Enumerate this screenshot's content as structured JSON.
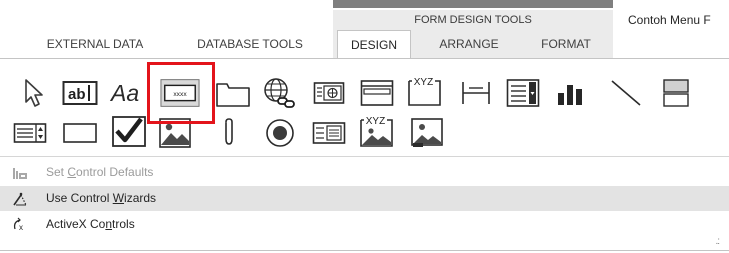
{
  "ribbon": {
    "context_group": "FORM DESIGN TOOLS",
    "app_title": "Contoh Menu F",
    "tabs": [
      {
        "label": "EXTERNAL DATA"
      },
      {
        "label": "DATABASE TOOLS"
      },
      {
        "label": "DESIGN",
        "active": true
      },
      {
        "label": "ARRANGE"
      },
      {
        "label": "FORMAT"
      }
    ]
  },
  "controls_gallery": {
    "row1": [
      "select-arrow-icon",
      "text-box-icon",
      "label-icon",
      "button-icon",
      "tab-control-icon",
      "hyperlink-icon",
      "web-browser-icon",
      "navigation-control-icon",
      "option-group-icon",
      "page-break-icon",
      "combo-box-icon",
      "chart-icon",
      "line-icon",
      "toggle-button-icon"
    ],
    "row2": [
      "list-box-icon",
      "rectangle-icon",
      "check-box-icon",
      "unbound-object-frame-icon",
      "attachment-icon",
      "option-button-icon",
      "subform-icon",
      "bound-object-frame-icon",
      "image-icon"
    ],
    "button_icon_text": "xxxx",
    "option_group_text": "XYZ",
    "bound_frame_text": "XYZ",
    "highlighted_control": "button-icon",
    "highlight_color": "#e3141b"
  },
  "menu": {
    "items": [
      {
        "label_pre": "Set ",
        "label_u": "C",
        "label_post": "ontrol Defaults",
        "enabled": false
      },
      {
        "label_pre": "Use Control ",
        "label_u": "W",
        "label_post": "izards",
        "enabled": true,
        "hovered": true
      },
      {
        "label_pre": "ActiveX Co",
        "label_u": "n",
        "label_post": "trols",
        "enabled": true
      }
    ]
  }
}
